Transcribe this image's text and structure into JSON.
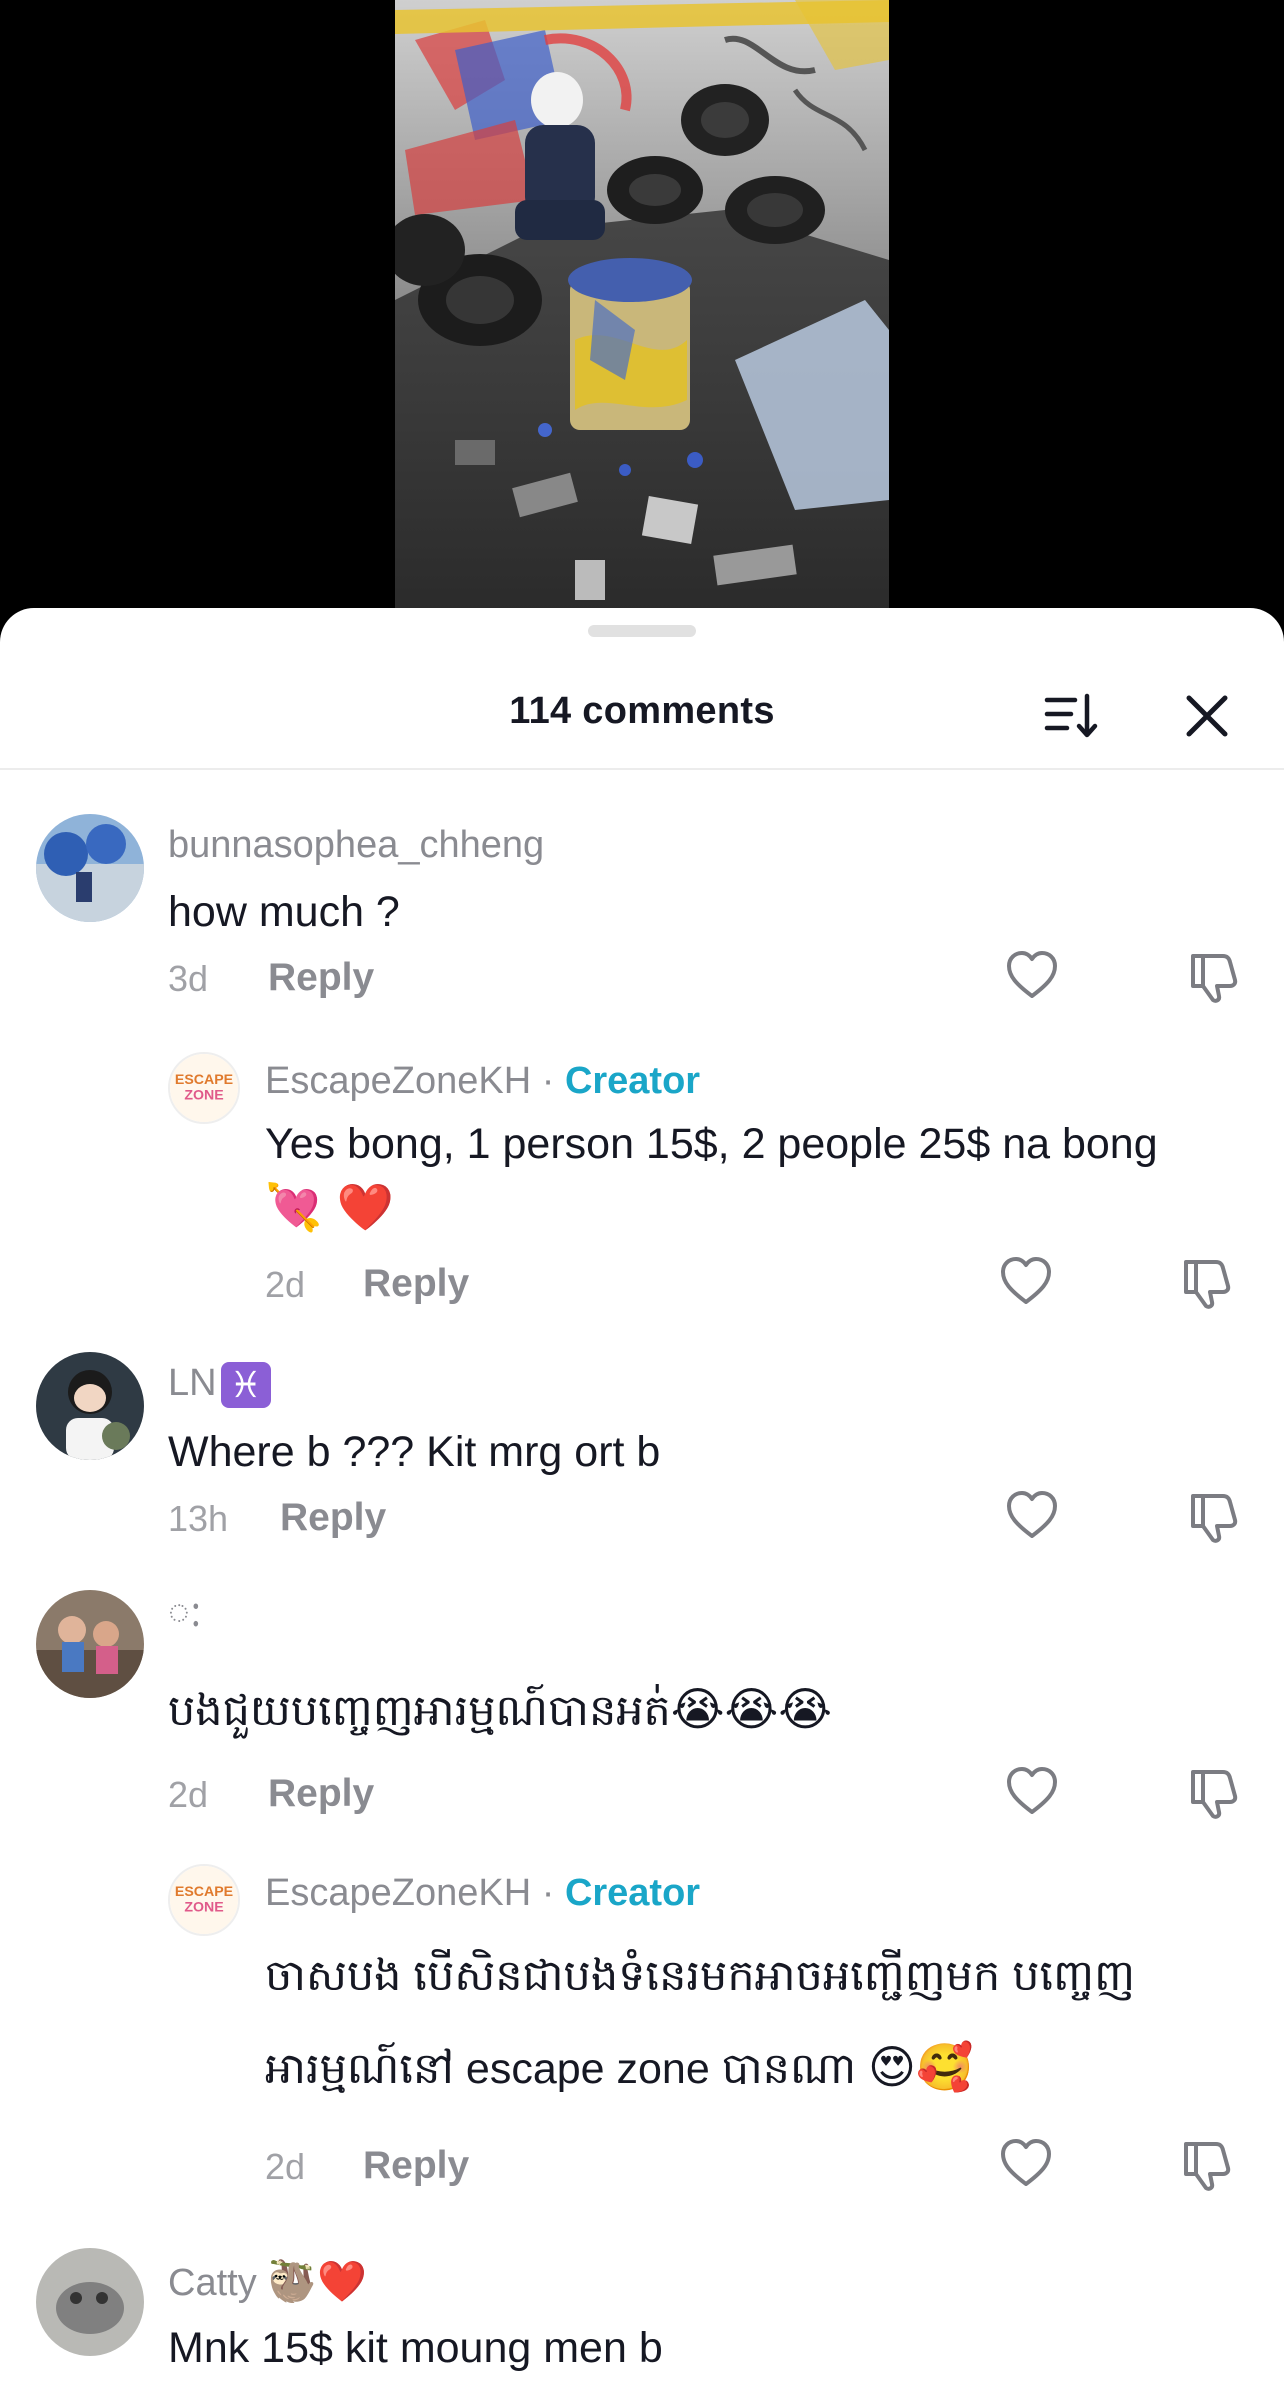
{
  "sheet": {
    "comment_count": "114 comments"
  },
  "comments": [
    {
      "username": "bunnasophea_chheng",
      "text": "how much ?",
      "time": "3d",
      "reply_label": "Reply"
    },
    {
      "username": "EscapeZoneKH",
      "creator_separator": "·",
      "creator_label": "Creator",
      "text": "Yes bong, 1 person 15$, 2 people 25$ na bong",
      "text_emoji": "💘 ❤️",
      "time": "2d",
      "reply_label": "Reply"
    },
    {
      "username": "LN",
      "username_badge": "♓",
      "text": "Where b ??? Kit mrg ort b",
      "time": "13h",
      "reply_label": "Reply"
    },
    {
      "username": "ៈ",
      "text": "បងជួយបញ្ចេញអារម្មណ៍បានអត់",
      "text_emoji": "😭😭😭",
      "time": "2d",
      "reply_label": "Reply"
    },
    {
      "username": "EscapeZoneKH",
      "creator_separator": "·",
      "creator_label": "Creator",
      "text_line1": "ចាសបង បើសិនជាបងទំនេរមកអាចអញ្ជើញមក បញ្ចេញ",
      "text_line2": "អារម្មណ៍នៅ escape zone បានណា",
      "text_emoji": "😍🥰",
      "time": "2d",
      "reply_label": "Reply"
    },
    {
      "username": "Catty",
      "username_emoji": "🦥❤️",
      "text": "Mnk 15$ kit moung men b"
    }
  ],
  "icons": {
    "sort": "sort-icon",
    "close": "close-icon",
    "like": "heart-icon",
    "dislike": "thumbs-down-icon"
  },
  "colors": {
    "creator": "#1aa6c8",
    "username": "#8a8b91",
    "text": "#161823"
  }
}
